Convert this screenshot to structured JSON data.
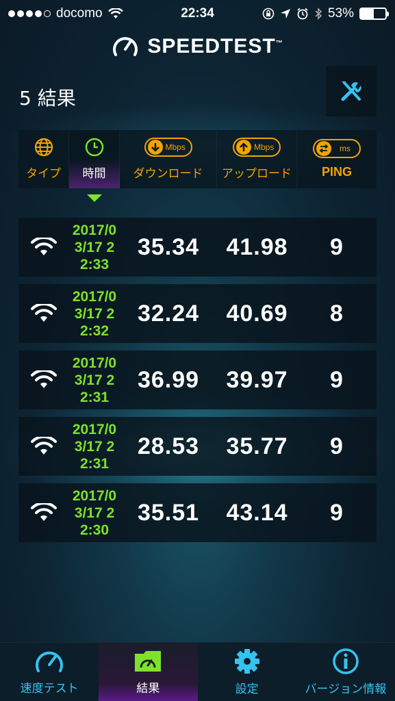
{
  "status_bar": {
    "carrier": "docomo",
    "time": "22:34",
    "battery_percent": "53%",
    "battery_level": 0.53,
    "signal_bars_filled": 4,
    "signal_bars_total": 5
  },
  "logo": {
    "text": "SPEEDTEST",
    "tm": "™"
  },
  "results_header": {
    "count_label": "5 結果"
  },
  "columns": {
    "type": "タイプ",
    "time": "時間",
    "download": "ダウンロード",
    "upload": "アップロード",
    "ping": "PING",
    "download_unit": "Mbps",
    "upload_unit": "Mbps",
    "ping_unit": "ms"
  },
  "results": [
    {
      "date": "2017/03/17",
      "time": "22:33",
      "download": "35.34",
      "upload": "41.98",
      "ping": "9"
    },
    {
      "date": "2017/03/17",
      "time": "22:32",
      "download": "32.24",
      "upload": "40.69",
      "ping": "8"
    },
    {
      "date": "2017/03/17",
      "time": "22:31",
      "download": "36.99",
      "upload": "39.97",
      "ping": "9"
    },
    {
      "date": "2017/03/17",
      "time": "22:31",
      "download": "28.53",
      "upload": "35.77",
      "ping": "9"
    },
    {
      "date": "2017/03/17",
      "time": "22:30",
      "download": "35.51",
      "upload": "43.14",
      "ping": "9"
    }
  ],
  "tabs": [
    {
      "label": "速度テスト",
      "icon": "speedometer-icon"
    },
    {
      "label": "結果",
      "icon": "results-folder-icon"
    },
    {
      "label": "設定",
      "icon": "gear-icon"
    },
    {
      "label": "バージョン情報",
      "icon": "info-icon"
    }
  ],
  "colors": {
    "accent_orange": "#f5a300",
    "accent_green": "#7ee22b",
    "accent_cyan": "#35c3f0",
    "active_purple": "#5a1a8a"
  }
}
